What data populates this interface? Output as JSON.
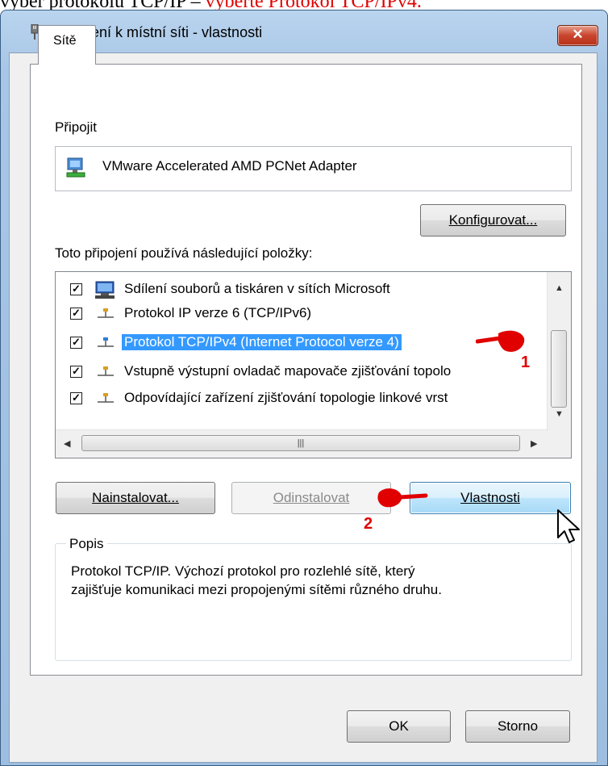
{
  "caption": {
    "prefix": "vyber protokolu TCP/IP – ",
    "highlight": "vyberte Protokol TCP/IPv4."
  },
  "window": {
    "title": "Připojení k místní síti - vlastnosti",
    "close_label": "✕"
  },
  "tab": {
    "label": "Sítě"
  },
  "connect": {
    "label": "Připojit",
    "adapter": "VMware Accelerated AMD PCNet Adapter",
    "configure_button": "Konfigurovat..."
  },
  "items_label": "Toto připojení používá následující položky:",
  "items": [
    {
      "label": "Sdílení souborů a tiskáren v sítích Microsoft",
      "checked": true,
      "icon": "network-share-icon"
    },
    {
      "label": "Protokol IP verze 6 (TCP/IPv6)",
      "checked": true,
      "icon": "protocol-icon"
    },
    {
      "label": "Protokol TCP/IPv4 (Internet Protocol verze 4)",
      "checked": true,
      "icon": "protocol-icon",
      "selected": true
    },
    {
      "label": "Vstupně výstupní ovladač mapovače zjišťování topolo",
      "checked": true,
      "icon": "protocol-icon"
    },
    {
      "label": "Odpovídající zařízení zjišťování topologie linkové vrst",
      "checked": true,
      "icon": "protocol-icon"
    }
  ],
  "buttons": {
    "install": "Nainstalovat...",
    "uninstall": "Odinstalovat",
    "properties": "Vlastnosti",
    "ok": "OK",
    "cancel": "Storno"
  },
  "description": {
    "legend": "Popis",
    "line1": "Protokol TCP/IP. Výchozí protokol pro rozlehlé sítě, který",
    "line2": "zajišťuje komunikaci mezi propojenými sítěmi různého druhu."
  },
  "annotations": {
    "step1": "1",
    "step2": "2"
  },
  "colors": {
    "selection": "#3399ff",
    "annotation": "#e00000"
  }
}
